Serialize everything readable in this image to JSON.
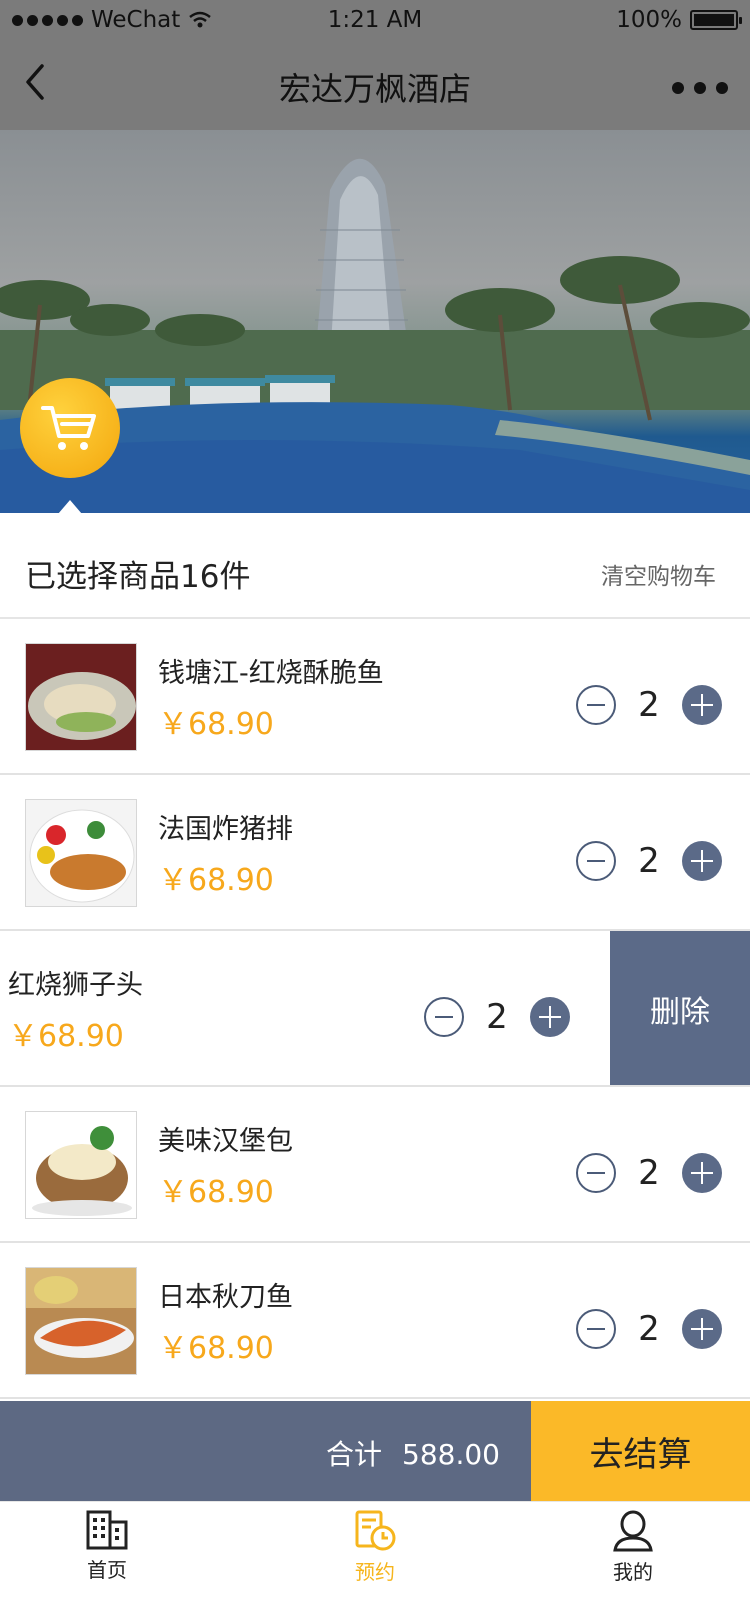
{
  "status_bar": {
    "carrier": "WeChat",
    "time": "1:21 AM",
    "battery": "100%"
  },
  "nav": {
    "title": "宏达万枫酒店"
  },
  "cart": {
    "selected_count_label": "已选择商品16件",
    "clear_label": "清空购物车",
    "items": [
      {
        "name": "钱塘江-红烧酥脆鱼",
        "price": "￥68.90",
        "qty": "2"
      },
      {
        "name": "法国炸猪排",
        "price": "￥68.90",
        "qty": "2"
      },
      {
        "name": "红烧狮子头",
        "price": "￥68.90",
        "qty": "2",
        "delete_label": "删除"
      },
      {
        "name": "美味汉堡包",
        "price": "￥68.90",
        "qty": "2"
      },
      {
        "name": "日本秋刀鱼",
        "price": "￥68.90",
        "qty": "2"
      }
    ]
  },
  "checkout": {
    "total_label": "合计",
    "total_value": "588.00",
    "pay_label": "去结算"
  },
  "tabbar": {
    "items": [
      {
        "label": "首页",
        "icon": "building-icon"
      },
      {
        "label": "预约",
        "icon": "calendar-clock-icon"
      },
      {
        "label": "我的",
        "icon": "user-icon"
      }
    ]
  },
  "colors": {
    "accent": "#f6b51d",
    "price": "#f7a81c",
    "navy": "#5b6a88"
  }
}
